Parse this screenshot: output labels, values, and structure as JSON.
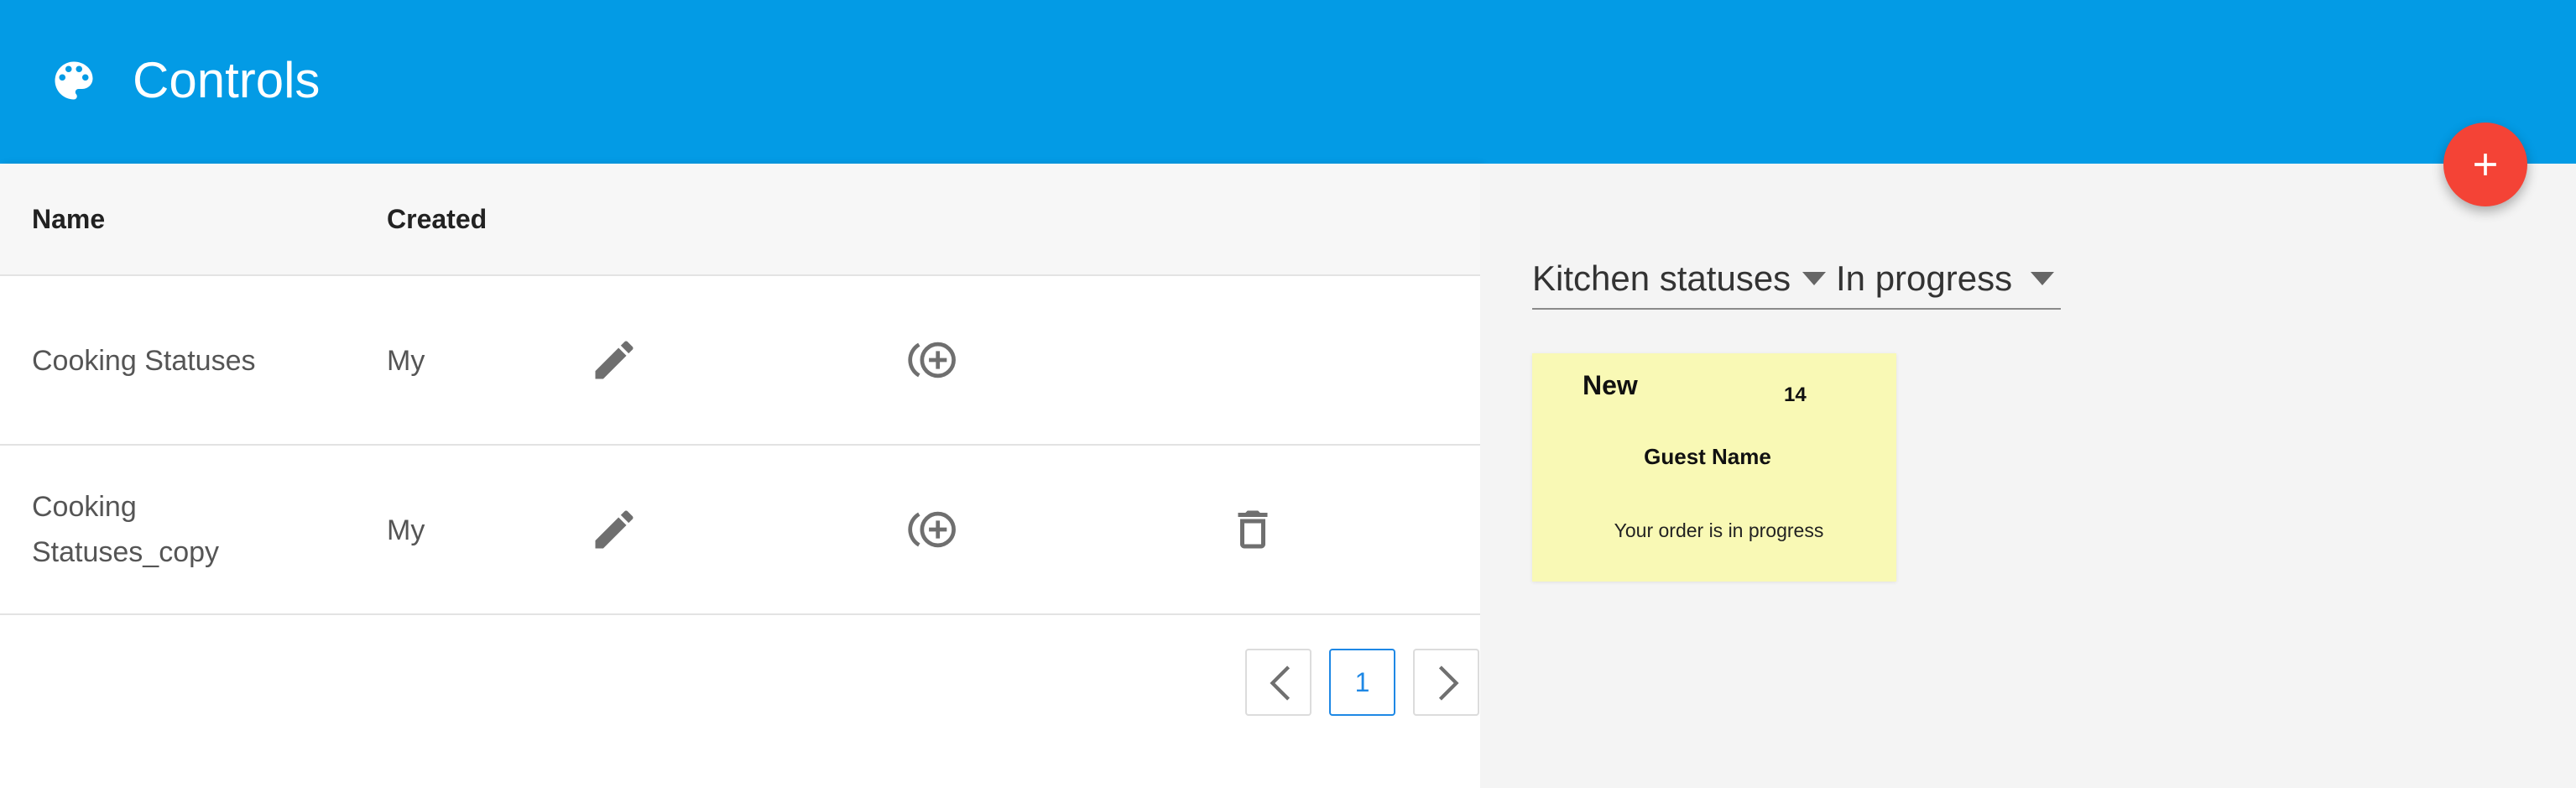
{
  "appbar": {
    "title": "Controls",
    "icon": "palette-icon",
    "color": "#039be5"
  },
  "fab": {
    "icon": "plus-icon",
    "color": "#f44336"
  },
  "table": {
    "columns": [
      "Name",
      "Created"
    ],
    "rows": [
      {
        "name": "Cooking Statuses",
        "created": "My",
        "actions": [
          "edit-icon",
          "add-circle-icon"
        ]
      },
      {
        "name": "Cooking Statuses_copy",
        "created": "My",
        "actions": [
          "edit-icon",
          "add-circle-icon",
          "trash-icon"
        ]
      }
    ]
  },
  "pagination": {
    "current_page": "1",
    "prev_icon": "chevron-left-icon",
    "next_icon": "chevron-right-icon"
  },
  "preview": {
    "group_select": "Kitchen statuses",
    "status_select": "In progress",
    "card": {
      "status": "New",
      "number": "14",
      "guest": "Guest Name",
      "message": "Your order is in progress",
      "background": "#f9f9b5"
    }
  }
}
